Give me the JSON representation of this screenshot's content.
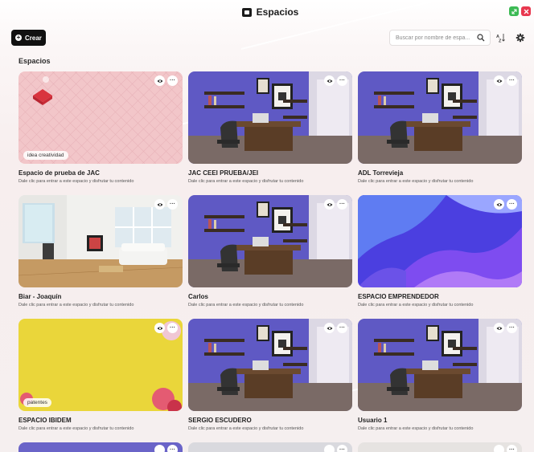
{
  "window": {
    "title": "Espacios"
  },
  "toolbar": {
    "create_label": "Crear",
    "search_placeholder": "Buscar por nombre de espa..."
  },
  "section": {
    "title": "Espacios"
  },
  "common": {
    "card_description": "Dale clic para entrar a este espacio y disfrutar tu contenido"
  },
  "cards": [
    {
      "title": "Espacio de prueba de JAC",
      "description": "Dale clic para entrar a este espacio y disfrutar tu contenido",
      "tag": "idea creatividad",
      "thumb": "pink-room"
    },
    {
      "title": "JAC CEEI PRUEBA/JEI",
      "description": "Dale clic para entrar a este espacio y disfrutar tu contenido",
      "tag": "",
      "thumb": "office"
    },
    {
      "title": "ADL Torrevieja",
      "description": "Dale clic para entrar a este espacio y disfrutar tu contenido",
      "tag": "",
      "thumb": "office"
    },
    {
      "title": "Biar - Joaquín",
      "description": "Dale clic para entrar a este espacio y disfrutar tu contenido",
      "tag": "",
      "thumb": "living-room"
    },
    {
      "title": "Carlos",
      "description": "Dale clic para entrar a este espacio y disfrutar tu contenido",
      "tag": "",
      "thumb": "office"
    },
    {
      "title": "ESPACIO EMPRENDEDOR",
      "description": "Dale clic para entrar a este espacio y disfrutar tu contenido",
      "tag": "",
      "thumb": "abstract-blue"
    },
    {
      "title": "ESPACIO IBIDEM",
      "description": "Dale clic para entrar a este espacio y disfrutar tu contenido",
      "tag": "patentes",
      "thumb": "yellow"
    },
    {
      "title": "SERGIO ESCUDERO",
      "description": "Dale clic para entrar a este espacio y disfrutar tu contenido",
      "tag": "",
      "thumb": "office"
    },
    {
      "title": "Usuario 1",
      "description": "Dale clic para entrar a este espacio y disfrutar tu contenido",
      "tag": "",
      "thumb": "office"
    }
  ],
  "colors": {
    "accent": "#111111",
    "maximize": "#3cba54",
    "close": "#e8384f",
    "office_wall": "#6a64c8"
  }
}
